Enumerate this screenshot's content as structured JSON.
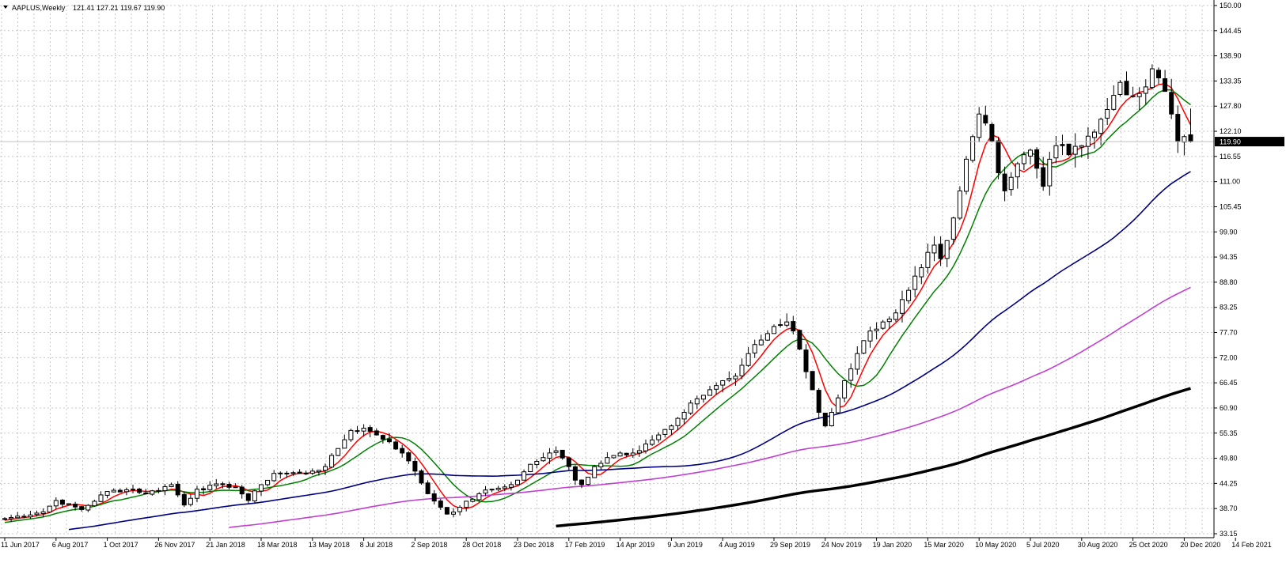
{
  "window": {
    "symbol": "AAPLUS,Weekly",
    "ohlc": "121.41 127.21 119.67 119.90",
    "current_price": "119.90"
  },
  "chart_data": {
    "type": "candlestick",
    "title": "AAPLUS,Weekly",
    "timeframe": "Weekly",
    "last_quote": {
      "open": 121.41,
      "high": 127.21,
      "low": 119.67,
      "close": 119.9
    },
    "ylim": [
      33.15,
      150.0
    ],
    "grid": true,
    "y_ticks": [
      "150.00",
      "144.45",
      "138.90",
      "133.35",
      "127.80",
      "122.10",
      "116.55",
      "111.00",
      "105.45",
      "99.90",
      "94.35",
      "88.80",
      "83.25",
      "77.70",
      "72.00",
      "66.45",
      "60.90",
      "55.35",
      "49.80",
      "44.25",
      "38.70",
      "33.15"
    ],
    "x_ticks": [
      "11 Jun 2017",
      "6 Aug 2017",
      "1 Oct 2017",
      "26 Nov 2017",
      "21 Jan 2018",
      "18 Mar 2018",
      "13 May 2018",
      "8 Jul 2018",
      "2 Sep 2018",
      "28 Oct 2018",
      "23 Dec 2018",
      "17 Feb 2019",
      "14 Apr 2019",
      "9 Jun 2019",
      "4 Aug 2019",
      "29 Sep 2019",
      "24 Nov 2019",
      "19 Jan 2020",
      "15 Mar 2020",
      "10 May 2020",
      "5 Jul 2020",
      "30 Aug 2020",
      "25 Oct 2020",
      "20 Dec 2020",
      "14 Feb 2021"
    ],
    "start_date": "2017-06-11",
    "close_anchors": [
      [
        0,
        36.5
      ],
      [
        6,
        38
      ],
      [
        8,
        40.5
      ],
      [
        12,
        38.5
      ],
      [
        16,
        42.5
      ],
      [
        20,
        43
      ],
      [
        22,
        42
      ],
      [
        26,
        44
      ],
      [
        28,
        39.5
      ],
      [
        30,
        43
      ],
      [
        34,
        44
      ],
      [
        36,
        43.5
      ],
      [
        38,
        40.5
      ],
      [
        40,
        44
      ],
      [
        42,
        46.5
      ],
      [
        46,
        46.5
      ],
      [
        48,
        47
      ],
      [
        50,
        48
      ],
      [
        52,
        52
      ],
      [
        54,
        56
      ],
      [
        56,
        56.5
      ],
      [
        58,
        55
      ],
      [
        60,
        53.5
      ],
      [
        62,
        51
      ],
      [
        64,
        47
      ],
      [
        66,
        42
      ],
      [
        68,
        39
      ],
      [
        69,
        37.5
      ],
      [
        71,
        39
      ],
      [
        74,
        42
      ],
      [
        76,
        43
      ],
      [
        78,
        43.5
      ],
      [
        80,
        45
      ],
      [
        82,
        48.5
      ],
      [
        84,
        50
      ],
      [
        86,
        51.5
      ],
      [
        88,
        48
      ],
      [
        89,
        45
      ],
      [
        90,
        44
      ],
      [
        92,
        48
      ],
      [
        94,
        50
      ],
      [
        96,
        51
      ],
      [
        98,
        51
      ],
      [
        100,
        53
      ],
      [
        102,
        55
      ],
      [
        104,
        57
      ],
      [
        106,
        60
      ],
      [
        108,
        63
      ],
      [
        110,
        65
      ],
      [
        112,
        67
      ],
      [
        114,
        68
      ],
      [
        116,
        73
      ],
      [
        118,
        76
      ],
      [
        120,
        79
      ],
      [
        122,
        80
      ],
      [
        123,
        78
      ],
      [
        124,
        74
      ],
      [
        125,
        69
      ],
      [
        126,
        65
      ],
      [
        127,
        60
      ],
      [
        128,
        57
      ],
      [
        129,
        60
      ],
      [
        131,
        67
      ],
      [
        133,
        73
      ],
      [
        135,
        78
      ],
      [
        137,
        80
      ],
      [
        139,
        82
      ],
      [
        141,
        87
      ],
      [
        143,
        92
      ],
      [
        145,
        97
      ],
      [
        146,
        94
      ],
      [
        147,
        98
      ],
      [
        148,
        103
      ],
      [
        149,
        109
      ],
      [
        150,
        116
      ],
      [
        151,
        121
      ],
      [
        152,
        126
      ],
      [
        153,
        124
      ],
      [
        154,
        120
      ],
      [
        155,
        113
      ],
      [
        156,
        109
      ],
      [
        157,
        112
      ],
      [
        158,
        115
      ],
      [
        159,
        117
      ],
      [
        160,
        118
      ],
      [
        161,
        114
      ],
      [
        162,
        110
      ],
      [
        163,
        116
      ],
      [
        164,
        119
      ],
      [
        166,
        117
      ],
      [
        168,
        119
      ],
      [
        170,
        122
      ],
      [
        172,
        127
      ],
      [
        174,
        133
      ],
      [
        176,
        130
      ],
      [
        178,
        132
      ],
      [
        179,
        136
      ],
      [
        180,
        134
      ],
      [
        181,
        131
      ],
      [
        182,
        126
      ],
      [
        183,
        120
      ],
      [
        184,
        121
      ],
      [
        185,
        119.9
      ]
    ],
    "series": [
      {
        "name": "",
        "kind": "sma",
        "period": 5,
        "color": "#ff0000"
      },
      {
        "name": "",
        "kind": "sma",
        "period": 10,
        "color": "#008000"
      },
      {
        "name": "",
        "kind": "sma",
        "period": 50,
        "color": "#000080"
      },
      {
        "name": "",
        "kind": "sma",
        "period": 100,
        "color": "#c040d0"
      },
      {
        "name": "",
        "kind": "sma",
        "period": 200,
        "color": "#000000"
      }
    ]
  },
  "colors": {
    "background": "#ffffff",
    "grid": "#c8c8c8",
    "bull_candle": "#ffffff",
    "bear_candle": "#000000",
    "candle_outline": "#000000",
    "current_price_line": "#c0c0c0",
    "price_label_bg": "#000000",
    "price_label_fg": "#ffffff"
  }
}
